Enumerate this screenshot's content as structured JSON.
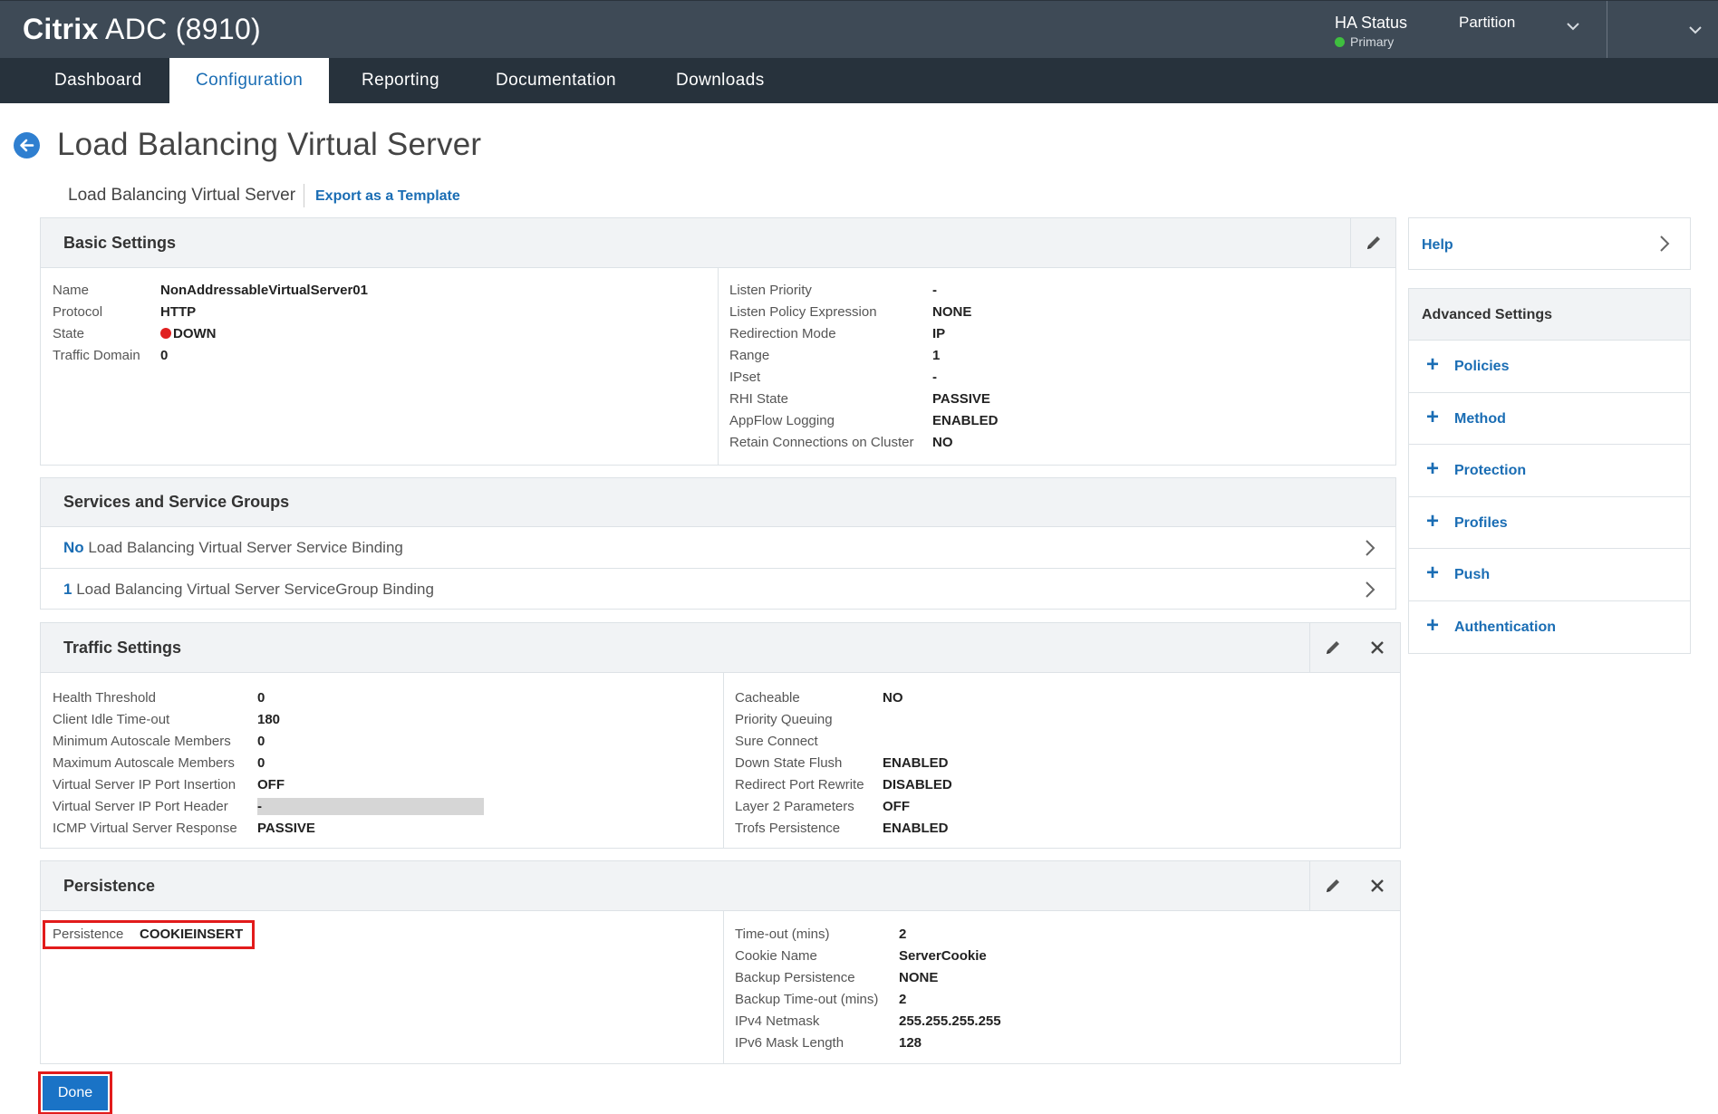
{
  "header": {
    "brand_bold": "Citrix",
    "brand_rest": "ADC (8910)",
    "ha_status_label": "HA Status",
    "ha_status_value": "Primary",
    "partition_label": "Partition"
  },
  "nav": {
    "tabs": [
      {
        "label": "Dashboard",
        "active": false
      },
      {
        "label": "Configuration",
        "active": true
      },
      {
        "label": "Reporting",
        "active": false
      },
      {
        "label": "Documentation",
        "active": false
      },
      {
        "label": "Downloads",
        "active": false
      }
    ]
  },
  "page": {
    "title": "Load Balancing Virtual Server",
    "subhead": "Load Balancing Virtual Server",
    "export_link": "Export as a Template"
  },
  "basic_settings": {
    "title": "Basic Settings",
    "left": [
      {
        "label": "Name",
        "value": "NonAddressableVirtualServer01"
      },
      {
        "label": "Protocol",
        "value": "HTTP"
      },
      {
        "label": "State",
        "value": "DOWN"
      },
      {
        "label": "Traffic Domain",
        "value": "0"
      }
    ],
    "right": [
      {
        "label": "Listen Priority",
        "value": "-"
      },
      {
        "label": "Listen Policy Expression",
        "value": "NONE"
      },
      {
        "label": "Redirection Mode",
        "value": "IP"
      },
      {
        "label": "Range",
        "value": "1"
      },
      {
        "label": "IPset",
        "value": "-"
      },
      {
        "label": "RHI State",
        "value": "PASSIVE"
      },
      {
        "label": "AppFlow Logging",
        "value": "ENABLED"
      },
      {
        "label": "Retain Connections on Cluster",
        "value": "NO"
      }
    ]
  },
  "services": {
    "title": "Services and Service Groups",
    "rows": [
      {
        "count": "No",
        "text": "Load Balancing Virtual Server Service Binding"
      },
      {
        "count": "1",
        "text": "Load Balancing Virtual Server ServiceGroup Binding"
      }
    ]
  },
  "traffic_settings": {
    "title": "Traffic Settings",
    "left": [
      {
        "label": "Health Threshold",
        "value": "0"
      },
      {
        "label": "Client Idle Time-out",
        "value": "180"
      },
      {
        "label": "Minimum Autoscale Members",
        "value": "0"
      },
      {
        "label": "Maximum Autoscale Members",
        "value": "0"
      },
      {
        "label": "Virtual Server IP Port Insertion",
        "value": "OFF"
      },
      {
        "label": "Virtual Server IP Port Header",
        "value": "-"
      },
      {
        "label": "ICMP Virtual Server Response",
        "value": "PASSIVE"
      }
    ],
    "right": [
      {
        "label": "Cacheable",
        "value": "NO"
      },
      {
        "label": "Priority Queuing",
        "value": ""
      },
      {
        "label": "Sure Connect",
        "value": ""
      },
      {
        "label": "Down State Flush",
        "value": "ENABLED"
      },
      {
        "label": "Redirect Port Rewrite",
        "value": "DISABLED"
      },
      {
        "label": "Layer 2 Parameters",
        "value": "OFF"
      },
      {
        "label": "Trofs Persistence",
        "value": "ENABLED"
      }
    ]
  },
  "persistence": {
    "title": "Persistence",
    "left": [
      {
        "label": "Persistence",
        "value": "COOKIEINSERT"
      }
    ],
    "right": [
      {
        "label": "Time-out (mins)",
        "value": "2"
      },
      {
        "label": "Cookie Name",
        "value": "ServerCookie"
      },
      {
        "label": "Backup Persistence",
        "value": "NONE"
      },
      {
        "label": "Backup Time-out (mins)",
        "value": "2"
      },
      {
        "label": "IPv4 Netmask",
        "value": "255.255.255.255"
      },
      {
        "label": "IPv6 Mask Length",
        "value": "128"
      }
    ]
  },
  "done_label": "Done",
  "sidebar": {
    "help_label": "Help",
    "advanced_title": "Advanced Settings",
    "items": [
      {
        "label": "Policies"
      },
      {
        "label": "Method"
      },
      {
        "label": "Protection"
      },
      {
        "label": "Profiles"
      },
      {
        "label": "Push"
      },
      {
        "label": "Authentication"
      }
    ]
  },
  "colors": {
    "header_bg": "#3e4a56",
    "nav_bg": "#27323c",
    "link": "#1a6db4",
    "done_button": "#1a73c6",
    "highlight": "#e21b1b",
    "state_down": "#e02020",
    "ha_ok": "#3fbf3f"
  }
}
